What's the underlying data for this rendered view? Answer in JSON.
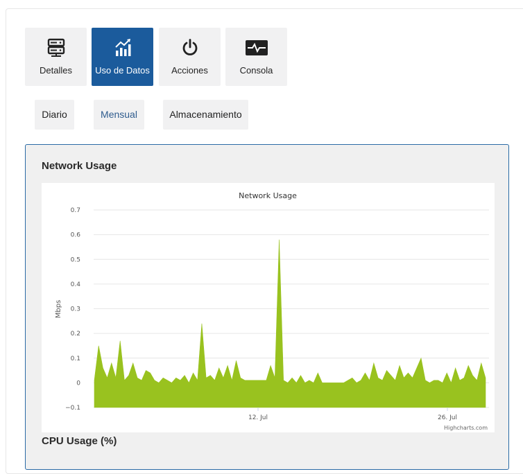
{
  "tabs": [
    {
      "label": "Detalles",
      "icon": "server-icon",
      "active": false
    },
    {
      "label": "Uso de Datos",
      "icon": "chart-icon",
      "active": true
    },
    {
      "label": "Acciones",
      "icon": "power-icon",
      "active": false
    },
    {
      "label": "Consola",
      "icon": "terminal-pulse-icon",
      "active": false
    }
  ],
  "subtabs": [
    {
      "label": "Diario",
      "selected": false
    },
    {
      "label": "Mensual",
      "selected": true
    },
    {
      "label": "Almacenamiento",
      "selected": false
    }
  ],
  "card": {
    "title": "Network Usage",
    "next_title": "CPU Usage (%)"
  },
  "colors": {
    "accent": "#1b5b9c",
    "series": "#99c21f"
  },
  "chart_data": {
    "type": "area",
    "title": "Network Usage",
    "ylabel": "Mbps",
    "xlabel": "",
    "ylim": [
      -0.1,
      0.7
    ],
    "yticks": [
      "0.7",
      "0.6",
      "0.5",
      "0.4",
      "0.3",
      "0.2",
      "0.1",
      "0",
      "−0.1"
    ],
    "xticks": [
      "12. Jul",
      "26. Jul"
    ],
    "credit": "Highcharts.com",
    "grid": true,
    "x": [
      "Jun 29",
      "Jun 29.3",
      "Jun 29.6",
      "Jun 30",
      "Jun 30.3",
      "Jun 30.6",
      "Jul 1",
      "Jul 1.3",
      "Jul 1.6",
      "Jul 2",
      "Jul 2.3",
      "Jul 2.6",
      "Jul 3",
      "Jul 3.3",
      "Jul 3.6",
      "Jul 4",
      "Jul 4.3",
      "Jul 4.6",
      "Jul 5",
      "Jul 5.3",
      "Jul 5.6",
      "Jul 6",
      "Jul 6.3",
      "Jul 6.6",
      "Jul 7",
      "Jul 7.3",
      "Jul 7.6",
      "Jul 8",
      "Jul 8.3",
      "Jul 8.6",
      "Jul 9",
      "Jul 9.3",
      "Jul 9.6",
      "Jul 10",
      "Jul 10.3",
      "Jul 10.6",
      "Jul 11",
      "Jul 11.3",
      "Jul 11.6",
      "Jul 12",
      "Jul 12.3",
      "Jul 12.6",
      "Jul 13",
      "Jul 13.3",
      "Jul 13.6",
      "Jul 14",
      "Jul 14.3",
      "Jul 14.6",
      "Jul 15",
      "Jul 15.3",
      "Jul 15.6",
      "Jul 16",
      "Jul 16.3",
      "Jul 16.6",
      "Jul 17",
      "Jul 17.3",
      "Jul 17.6",
      "Jul 18",
      "Jul 18.3",
      "Jul 18.6",
      "Jul 19",
      "Jul 19.3",
      "Jul 19.6",
      "Jul 20",
      "Jul 20.3",
      "Jul 20.6",
      "Jul 21",
      "Jul 21.3",
      "Jul 21.6",
      "Jul 22",
      "Jul 22.3",
      "Jul 22.6",
      "Jul 23",
      "Jul 23.3",
      "Jul 23.6",
      "Jul 24",
      "Jul 24.3",
      "Jul 24.6",
      "Jul 25",
      "Jul 25.3",
      "Jul 25.6",
      "Jul 26",
      "Jul 26.3",
      "Jul 26.6",
      "Jul 27",
      "Jul 27.3",
      "Jul 27.6",
      "Jul 28",
      "Jul 28.3",
      "Jul 28.6",
      "Jul 29",
      "Jul 29.3"
    ],
    "series": [
      {
        "name": "",
        "values": [
          0.01,
          0.15,
          0.06,
          0.02,
          0.08,
          0.02,
          0.17,
          0.01,
          0.03,
          0.08,
          0.02,
          0.01,
          0.05,
          0.04,
          0.01,
          0.0,
          0.02,
          0.01,
          0.0,
          0.02,
          0.01,
          0.03,
          0.0,
          0.04,
          0.01,
          0.24,
          0.02,
          0.03,
          0.01,
          0.06,
          0.02,
          0.07,
          0.01,
          0.09,
          0.02,
          0.01,
          0.01,
          0.01,
          0.01,
          0.01,
          0.01,
          0.07,
          0.02,
          0.58,
          0.01,
          0.0,
          0.02,
          0.0,
          0.03,
          0.0,
          0.01,
          0.0,
          0.04,
          0.0,
          0.0,
          0.0,
          0.0,
          0.0,
          0.0,
          0.01,
          0.02,
          0.0,
          0.01,
          0.04,
          0.01,
          0.08,
          0.02,
          0.01,
          0.05,
          0.03,
          0.01,
          0.07,
          0.02,
          0.04,
          0.02,
          0.06,
          0.1,
          0.01,
          0.0,
          0.01,
          0.01,
          0.0,
          0.04,
          0.0,
          0.06,
          0.01,
          0.02,
          0.07,
          0.03,
          0.01,
          0.08,
          0.02
        ]
      }
    ]
  }
}
